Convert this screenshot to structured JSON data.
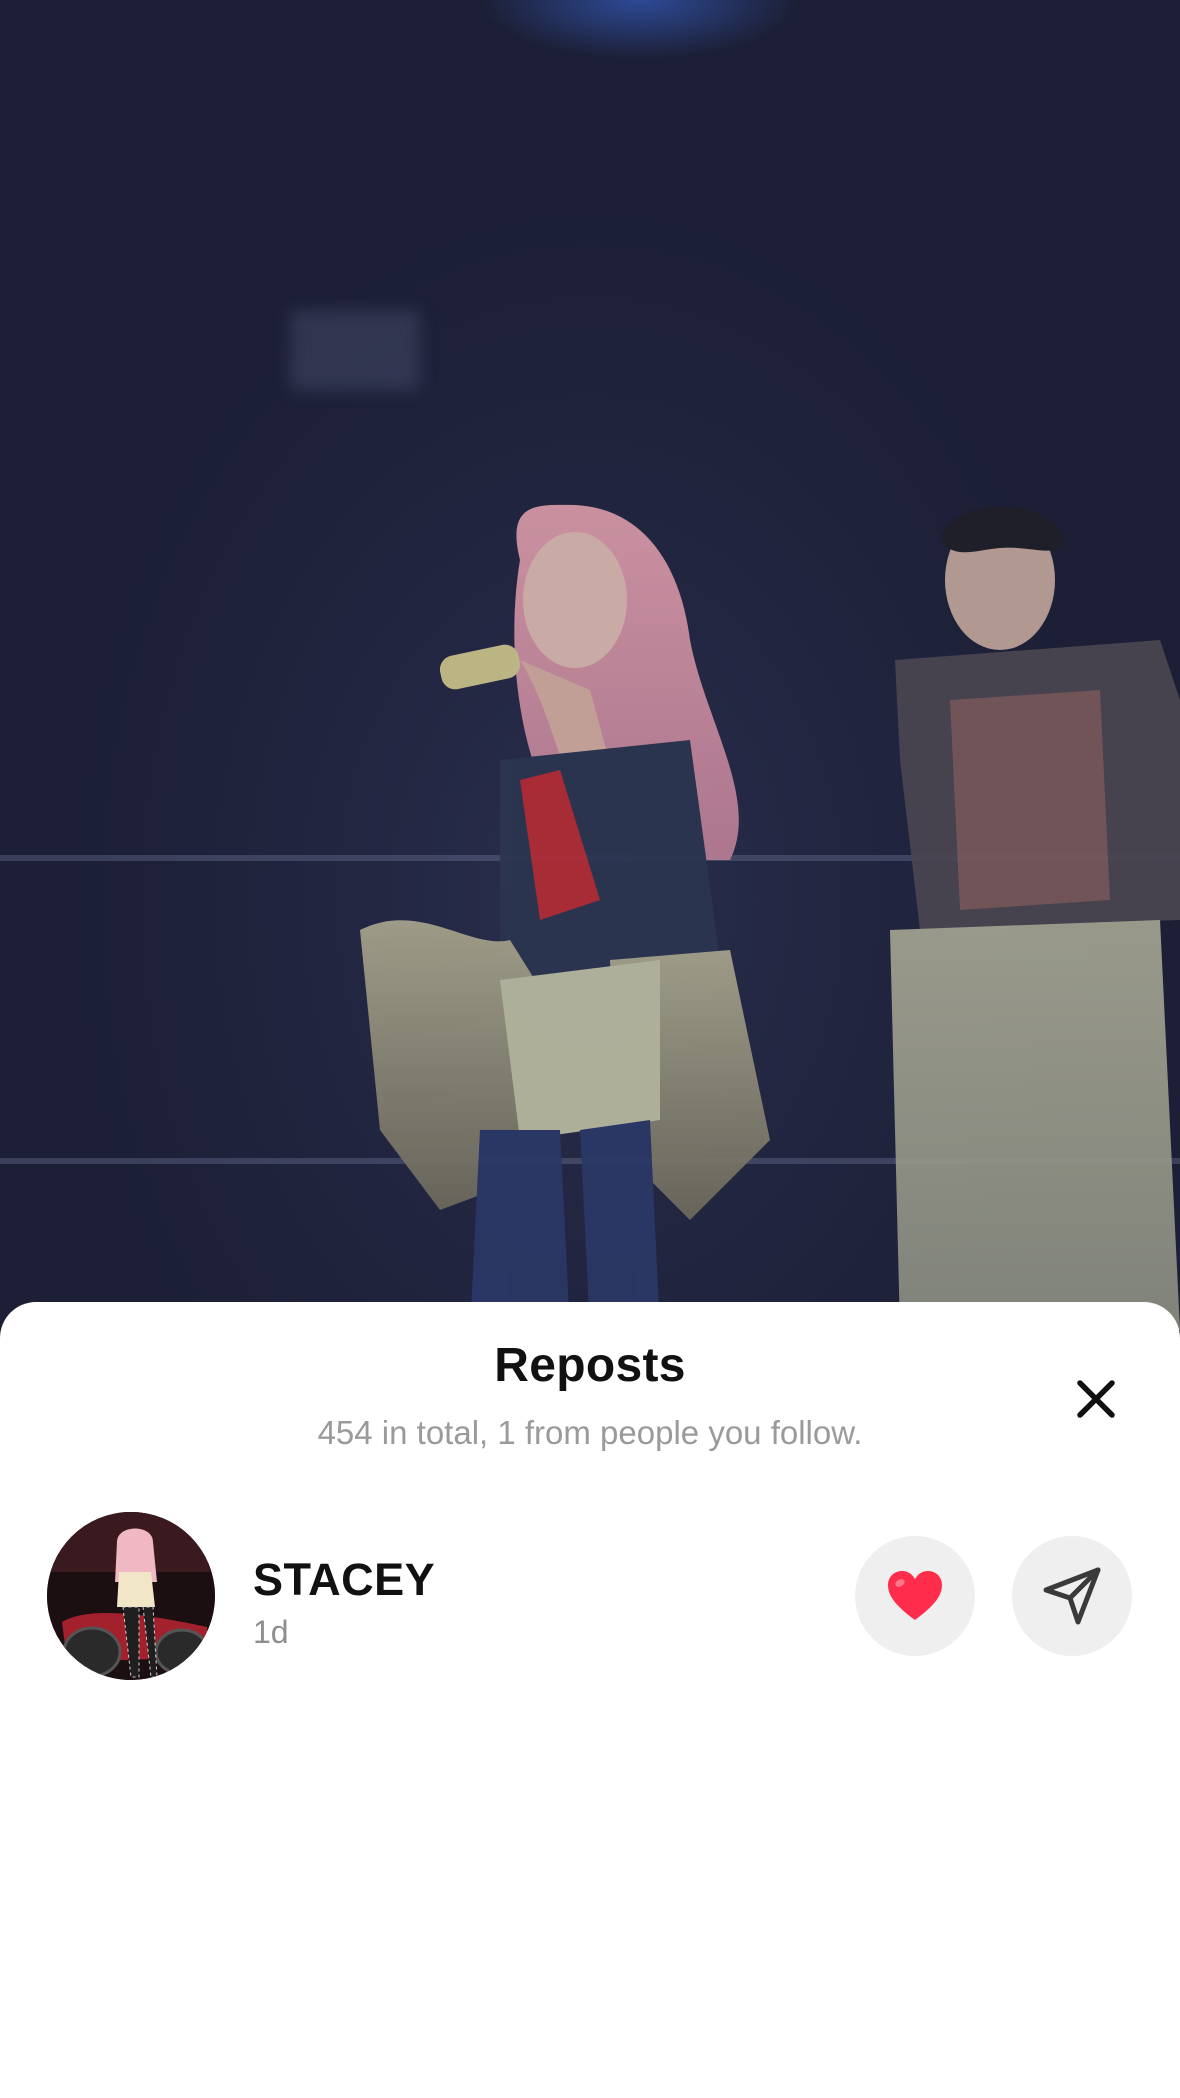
{
  "video": {
    "description_icon": "concert-video-frame"
  },
  "sheet": {
    "title": "Reposts",
    "subtitle": "454 in total, 1 from people you follow.",
    "close_icon": "close-icon"
  },
  "reposts": [
    {
      "username": "STACEY",
      "time": "1d",
      "avatar_icon": "avatar",
      "like_icon": "heart-icon",
      "like_color": "#ff2d4b",
      "share_icon": "send-icon"
    }
  ],
  "colors": {
    "sheet_bg": "#ffffff",
    "button_bg": "#efefef",
    "subtitle": "#9a9a9a"
  }
}
